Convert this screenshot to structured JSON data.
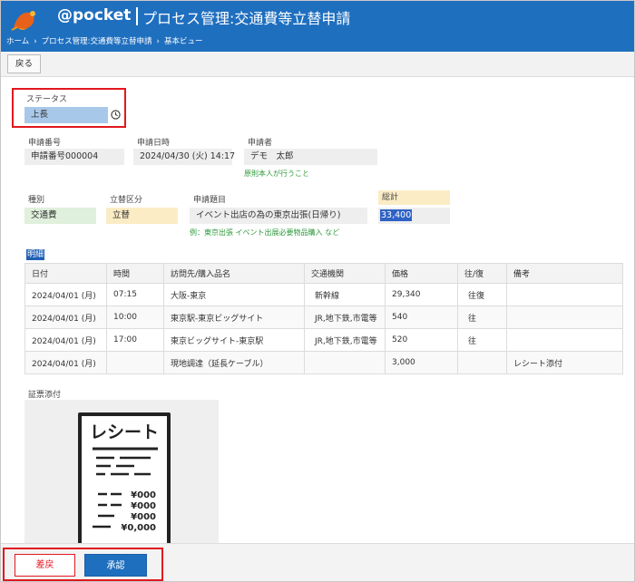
{
  "header": {
    "logo_text": "@pocket",
    "app_title": "プロセス管理:交通費等立替申請",
    "breadcrumb": [
      "ホーム",
      "プロセス管理:交通費等立替申請",
      "基本ビュー"
    ],
    "breadcrumb_sep": "›",
    "bg_color": "#1f6fbf"
  },
  "toolbar": {
    "back_label": "戻る"
  },
  "status": {
    "label": "ステータス",
    "value": "上長",
    "value_color": "#a8c8ea",
    "icon": "clock-icon"
  },
  "fields": {
    "app_no_label": "申請番号",
    "app_no": "申請番号000004",
    "app_date_label": "申請日時",
    "app_date": "2024/04/30 (火) 14:17",
    "applicant_label": "申請者",
    "applicant": "デモ　太郎",
    "applicant_hint": "原則本人が行うこと",
    "type_label": "種別",
    "type": "交通費",
    "type_color": "#dff0dc",
    "advance_label": "立替区分",
    "advance": "立替",
    "advance_color": "#fbecc5",
    "subject_label": "申請題目",
    "subject": "イベント出店の為の東京出張(日帰り)",
    "subject_hint": "例：東京出張 イベント出展必要物品購入 など",
    "total_label": "総計",
    "total": "33,400",
    "total_label_color": "#fbecc5"
  },
  "detail": {
    "label": "明細",
    "columns": [
      "日付",
      "時間",
      "訪問先/購入品名",
      "交通機関",
      "価格",
      "往/復",
      "備考"
    ],
    "rows": [
      [
        "2024/04/01 (月)",
        "07:15",
        "大阪-東京",
        "新幹線",
        "29,340",
        "往復",
        ""
      ],
      [
        "2024/04/01 (月)",
        "10:00",
        "東京駅-東京ビッグサイト",
        "JR,地下鉄,市電等",
        "540",
        "往",
        ""
      ],
      [
        "2024/04/01 (月)",
        "17:00",
        "東京ビッグサイト-東京駅",
        "JR,地下鉄,市電等",
        "520",
        "往",
        ""
      ],
      [
        "2024/04/01 (月)",
        "",
        "現地調達（延長ケーブル）",
        "",
        "3,000",
        "",
        "レシート添付"
      ]
    ]
  },
  "attachment": {
    "label": "証票添付",
    "receipt": {
      "title": "レシート",
      "amounts": [
        "¥000",
        "¥000",
        "¥000",
        "¥0,000"
      ]
    }
  },
  "footer": {
    "reject_label": "差戻",
    "approve_label": "承認"
  }
}
